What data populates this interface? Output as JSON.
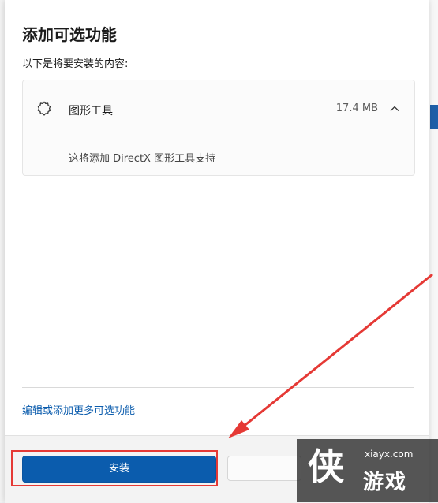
{
  "dialog": {
    "title": "添加可选功能",
    "subtitle": "以下是将要安装的内容:"
  },
  "feature": {
    "icon": "gear-icon",
    "name": "图形工具",
    "size": "17.4 MB",
    "expand_icon": "chevron-up-icon",
    "description": "这将添加 DirectX 图形工具支持"
  },
  "more_link": "编辑或添加更多可选功能",
  "footer": {
    "install_label": "安装"
  },
  "watermark": {
    "logo": "侠",
    "url": "xiayx.com",
    "text": "游戏"
  },
  "colors": {
    "accent": "#0b5cad",
    "annotation": "#e53935"
  }
}
